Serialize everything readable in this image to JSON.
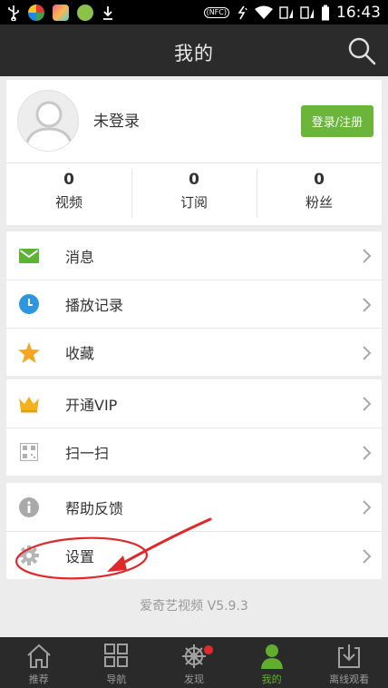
{
  "status_bar": {
    "nfc": "(NFC)",
    "time": "16:43"
  },
  "header": {
    "title": "我的"
  },
  "profile": {
    "username": "未登录",
    "login_button": "登录/注册",
    "stats": [
      {
        "value": "0",
        "label": "视频"
      },
      {
        "value": "0",
        "label": "订阅"
      },
      {
        "value": "0",
        "label": "粉丝"
      }
    ]
  },
  "menu_groups": [
    {
      "items": [
        {
          "label": "消息",
          "icon": "message-icon"
        },
        {
          "label": "播放记录",
          "icon": "clock-icon"
        },
        {
          "label": "收藏",
          "icon": "star-icon"
        }
      ]
    },
    {
      "items": [
        {
          "label": "开通VIP",
          "icon": "crown-icon"
        },
        {
          "label": "扫一扫",
          "icon": "qr-scan-icon"
        }
      ]
    },
    {
      "items": [
        {
          "label": "帮助反馈",
          "icon": "info-icon"
        },
        {
          "label": "设置",
          "icon": "gear-icon"
        }
      ]
    }
  ],
  "version": "爱奇艺视频 V5.9.3",
  "tabs": [
    {
      "label": "推荐",
      "icon": "home-icon",
      "active": false
    },
    {
      "label": "导航",
      "icon": "grid-icon",
      "active": false
    },
    {
      "label": "发现",
      "icon": "wheel-icon",
      "active": false,
      "badge": true
    },
    {
      "label": "我的",
      "icon": "person-icon",
      "active": true
    },
    {
      "label": "离线观看",
      "icon": "download-icon",
      "active": false
    }
  ],
  "colors": {
    "accent_green": "#6ab53a",
    "header_bg": "#2b2b2b",
    "annotation_red": "#e0282a"
  }
}
